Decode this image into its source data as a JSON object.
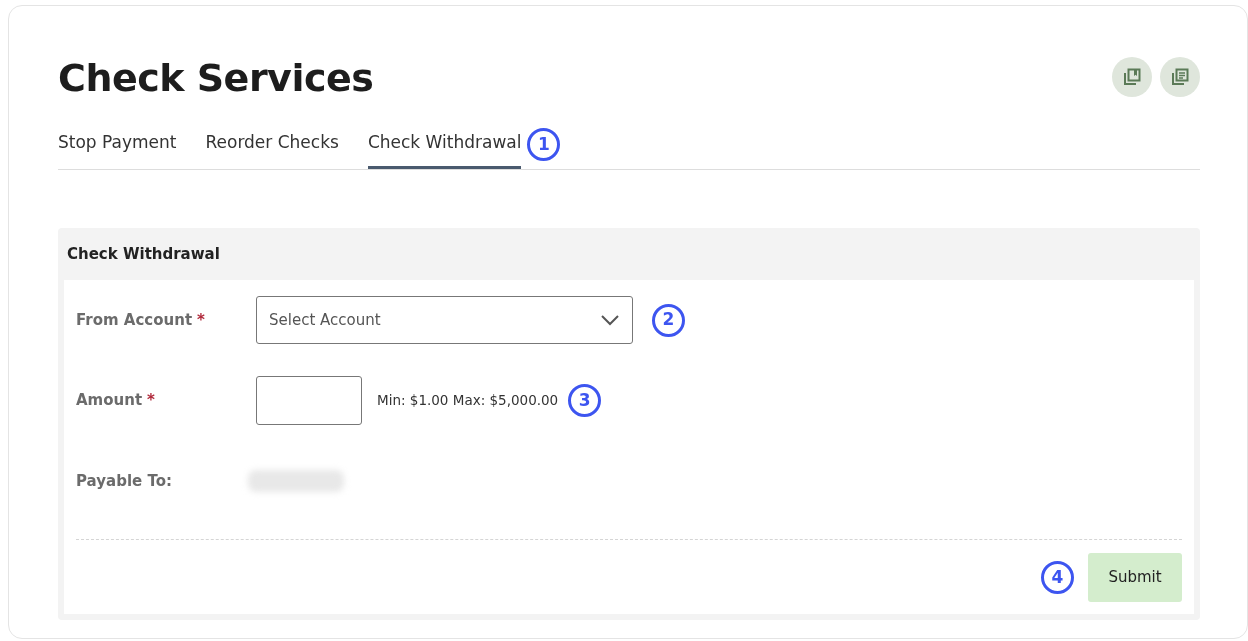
{
  "page": {
    "title": "Check Services"
  },
  "toolbar_icons": [
    {
      "kind": "bookmark"
    },
    {
      "kind": "document"
    }
  ],
  "tabs": [
    {
      "label": "Stop Payment",
      "selected": false
    },
    {
      "label": "Reorder Checks",
      "selected": false
    },
    {
      "label": "Check Withdrawal",
      "selected": true,
      "callout": "1"
    }
  ],
  "panel": {
    "title": "Check Withdrawal",
    "fields": [
      {
        "kind": "select",
        "label": "From Account",
        "required_mark": "*",
        "placeholder": "Select Account",
        "callout": "2"
      },
      {
        "kind": "input",
        "label": "Amount",
        "required_mark": "*",
        "hint": "Min: $1.00 Max: $5,000.00",
        "callout": "3"
      },
      {
        "kind": "redacted",
        "label": "Payable To:"
      }
    ],
    "submit": {
      "label": "Submit",
      "callout": "4"
    }
  }
}
